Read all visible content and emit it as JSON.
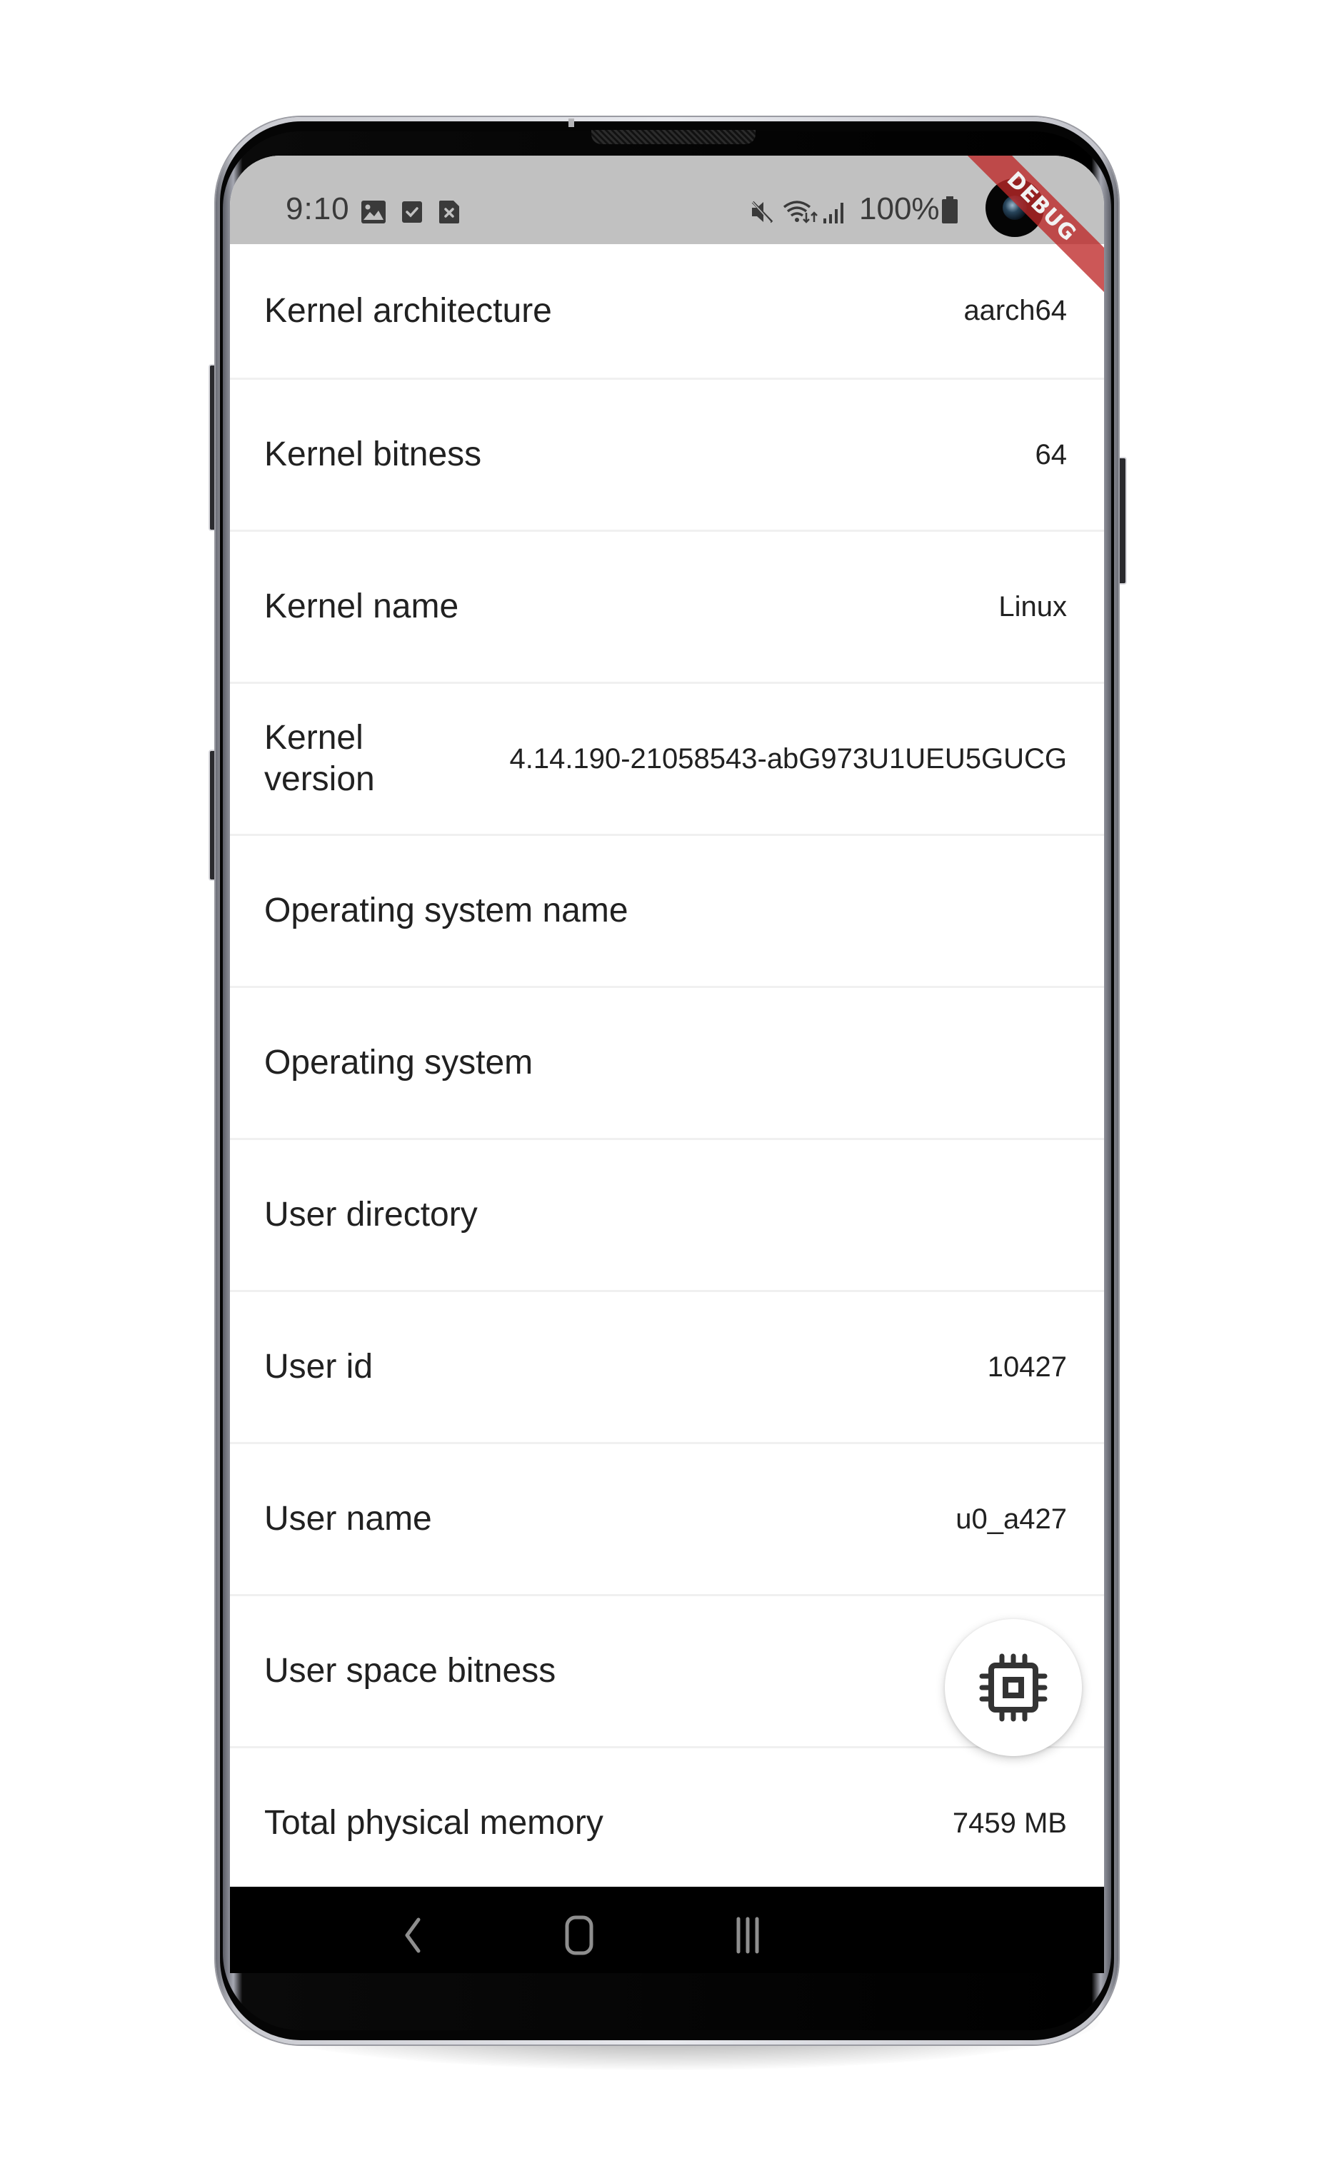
{
  "status_bar": {
    "time": "9:10",
    "left_icons": [
      "image-notification-icon",
      "checkbox-notification-icon",
      "sim-error-icon"
    ],
    "right_icons": [
      "mute-icon",
      "wifi-icon",
      "signal-icon"
    ],
    "battery_text": "100%",
    "battery_icon": "battery-full-icon"
  },
  "debug_banner": "DEBUG",
  "rows": [
    {
      "label": "Kernel architecture",
      "value": "aarch64"
    },
    {
      "label": "Kernel bitness",
      "value": "64"
    },
    {
      "label": "Kernel name",
      "value": "Linux"
    },
    {
      "label": "Kernel version",
      "value": "4.14.190-21058543-abG973U1UEU5GUCG"
    },
    {
      "label": "Operating system name",
      "value": ""
    },
    {
      "label": "Operating system",
      "value": ""
    },
    {
      "label": "User directory",
      "value": ""
    },
    {
      "label": "User id",
      "value": "10427"
    },
    {
      "label": "User name",
      "value": "u0_a427"
    },
    {
      "label": "User space bitness",
      "value": ""
    },
    {
      "label": "Total physical memory",
      "value": "7459 MB"
    }
  ],
  "fab": {
    "icon": "memory-chip-icon"
  },
  "navbar": {
    "buttons": [
      "back-icon",
      "home-icon",
      "recents-icon"
    ]
  },
  "colors": {
    "status_bar_bg": "#c1c1c1",
    "status_text": "#3a3a3a",
    "text_primary": "#212121",
    "divider": "#f0f0f0",
    "debug_banner": "#be2828",
    "navbar_bg": "#000000",
    "nav_icon": "#8e8e8e"
  }
}
